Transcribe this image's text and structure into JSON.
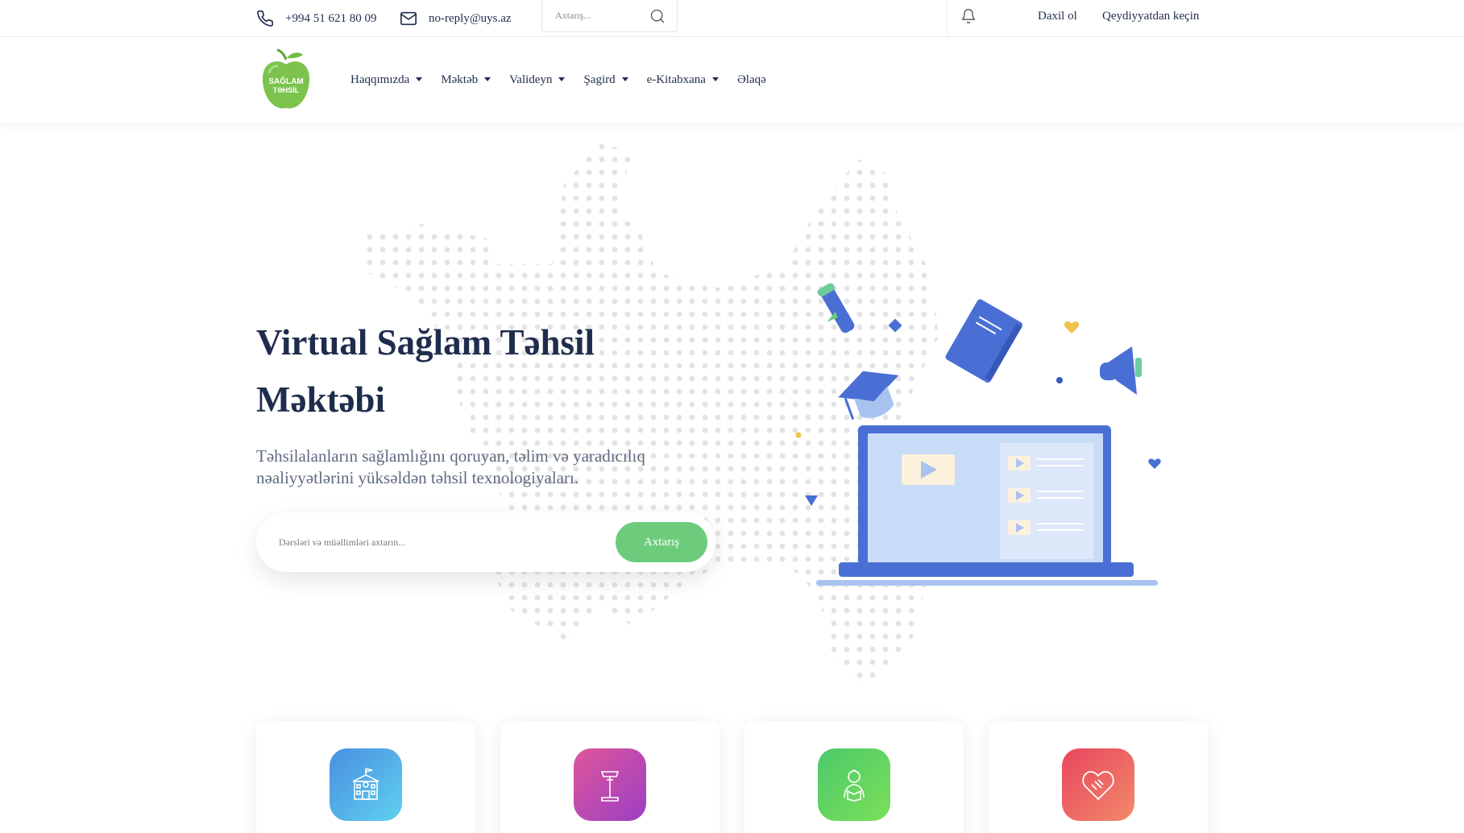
{
  "topbar": {
    "phone": "+994 51 621 80 09",
    "email": "no-reply@uys.az",
    "search_placeholder": "Axtarış...",
    "login": "Daxil ol",
    "register": "Qeydiyyatdan keçin"
  },
  "logo": {
    "line1": "SAĞLAM",
    "line2": "TƏHSİL"
  },
  "nav": {
    "items": [
      {
        "label": "Haqqımızda"
      },
      {
        "label": "Məktəb"
      },
      {
        "label": "Valideyn"
      },
      {
        "label": "Şagird"
      },
      {
        "label": "e-Kitabxana"
      },
      {
        "label": "Əlaqə"
      }
    ]
  },
  "hero": {
    "title_line1": "Virtual Sağlam Təhsil",
    "title_line2": "Məktəbi",
    "subtitle_line1": "Təhsilalanların sağlamlığını qoruyan, təlim və yaradıcılıq",
    "subtitle_line2": "nəaliyyətlərini yüksəldən təhsil texnologiyaları.",
    "search_placeholder": "Dərsləri və müəllimləri axtarın...",
    "search_button": "Axtarış"
  },
  "cards": [
    {
      "icon": "school-icon",
      "gradient": [
        "#4a8fe0",
        "#5fd0f0"
      ]
    },
    {
      "icon": "podium-icon",
      "gradient": [
        "#e0569a",
        "#9b3fc4"
      ]
    },
    {
      "icon": "student-icon",
      "gradient": [
        "#4cc96a",
        "#7be05a"
      ]
    },
    {
      "icon": "handshake-heart-icon",
      "gradient": [
        "#e8455e",
        "#f28a6a"
      ]
    }
  ],
  "colors": {
    "primary_text": "#1f2d4d",
    "accent_green": "#6ccc7c",
    "illustration_blue": "#4a6fd4"
  }
}
